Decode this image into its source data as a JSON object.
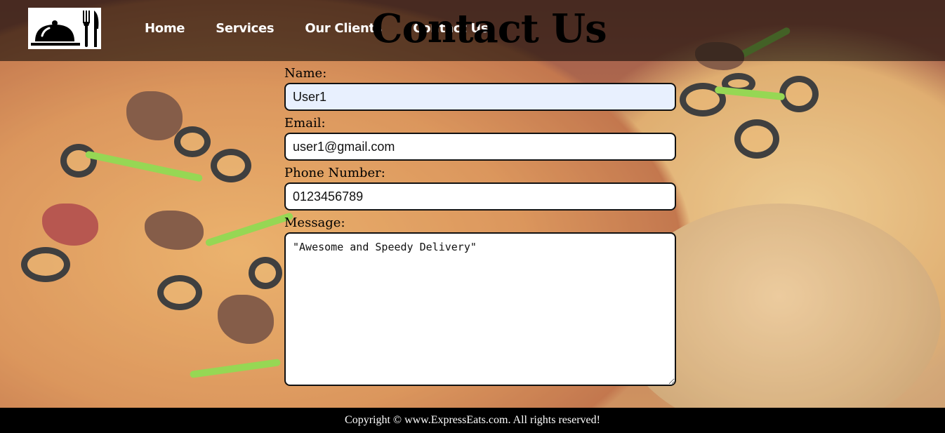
{
  "header": {
    "logo_icon": "cloche-fork-knife-icon",
    "nav": [
      {
        "label": "Home"
      },
      {
        "label": "Services"
      },
      {
        "label": "Our Clients"
      },
      {
        "label": "Contact Us"
      }
    ]
  },
  "page_title": "Contact Us",
  "form": {
    "name_label": "Name:",
    "name_value": "User1",
    "email_label": "Email:",
    "email_value": "user1@gmail.com",
    "phone_label": "Phone Number:",
    "phone_value": "0123456789",
    "message_label": "Message:",
    "message_value": "\"Awesome and Speedy Delivery\""
  },
  "footer": {
    "copyright": "Copyright © www.ExpressEats.com. All rights reserved!"
  },
  "colors": {
    "header_overlay": "#000000",
    "autofill_bg": "#e8f0fe",
    "footer_bg": "#000000"
  }
}
